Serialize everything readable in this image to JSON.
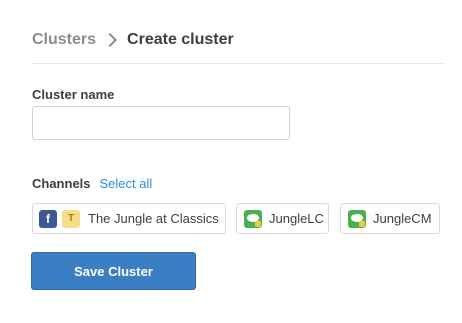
{
  "breadcrumb": {
    "parent": "Clusters",
    "current": "Create cluster"
  },
  "form": {
    "name_label": "Cluster name",
    "name_value": "",
    "name_placeholder": "",
    "channels_label": "Channels",
    "select_all": "Select all"
  },
  "channels": [
    {
      "label": "The Jungle at Classics",
      "icons": [
        "facebook-icon",
        "t-badge-icon"
      ],
      "icon_text": {
        "facebook": "f",
        "badge": "T"
      }
    },
    {
      "label": "JungleLC",
      "icons": [
        "chat-app-icon"
      ]
    },
    {
      "label": "JungleCM",
      "icons": [
        "chat-app-icon"
      ]
    }
  ],
  "actions": {
    "save": "Save Cluster"
  },
  "colors": {
    "accent": "#3a7ec3",
    "link": "#2f8fd8",
    "facebook": "#3b5998",
    "app_green": "#4caf50"
  }
}
